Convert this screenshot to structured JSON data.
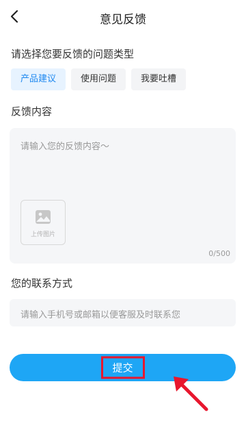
{
  "nav": {
    "title": "意见反馈",
    "back_icon": "chevron-left-icon"
  },
  "type_section": {
    "label": "请选择您要反馈的问题类型",
    "tabs": [
      {
        "label": "产品建议",
        "active": true
      },
      {
        "label": "使用问题",
        "active": false
      },
      {
        "label": "我要吐槽",
        "active": false
      }
    ]
  },
  "content_section": {
    "label": "反馈内容",
    "placeholder": "请输入您的反馈内容～",
    "upload_label": "上传图片",
    "upload_icon": "image-icon",
    "counter": "0/500"
  },
  "contact_section": {
    "label": "您的联系方式",
    "placeholder": "请输入手机号或邮箱以便客服及时联系您"
  },
  "submit": {
    "label": "提交"
  },
  "colors": {
    "accent": "#1ea6f5",
    "tab_active_bg": "#e7f3ff",
    "tab_active_text": "#1e88f0",
    "annotation": "#e8172e"
  }
}
